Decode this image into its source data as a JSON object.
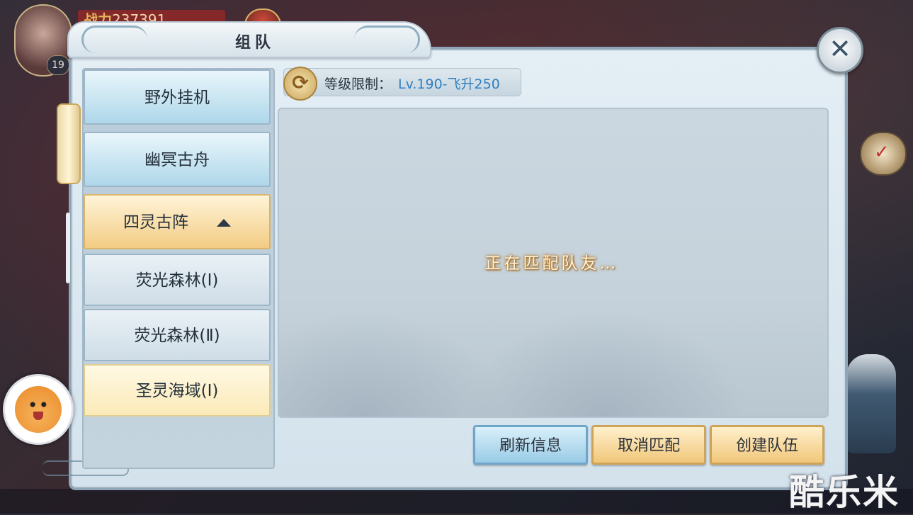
{
  "hud": {
    "power_label": "战力",
    "power_value": "237391",
    "level": "19"
  },
  "dialog": {
    "title": "组队",
    "close_label": "✕"
  },
  "categories": [
    {
      "label": "野外挂机"
    },
    {
      "label": "幽冥古舟"
    },
    {
      "label": "四灵古阵",
      "expanded": true
    }
  ],
  "subitems": [
    {
      "label": "荧光森林(Ⅰ)"
    },
    {
      "label": "荧光森林(Ⅱ)"
    },
    {
      "label": "圣灵海域(Ⅰ)",
      "selected": true
    }
  ],
  "level_limit": {
    "label": "等级限制：",
    "value": "Lv.190-飞升250"
  },
  "status_text": "正在匹配队友…",
  "buttons": {
    "refresh": "刷新信息",
    "cancel": "取消匹配",
    "create": "创建队伍"
  },
  "watermark": "酷乐米",
  "icons": [
    "refresh-icon",
    "close-icon",
    "calendar-icon",
    "mascot-icon",
    "expand-arrow-icon"
  ],
  "colors": {
    "accent_blue": "#2f7fc2",
    "active_tab": "#f3cc84",
    "selected_row": "#fbeab8"
  }
}
